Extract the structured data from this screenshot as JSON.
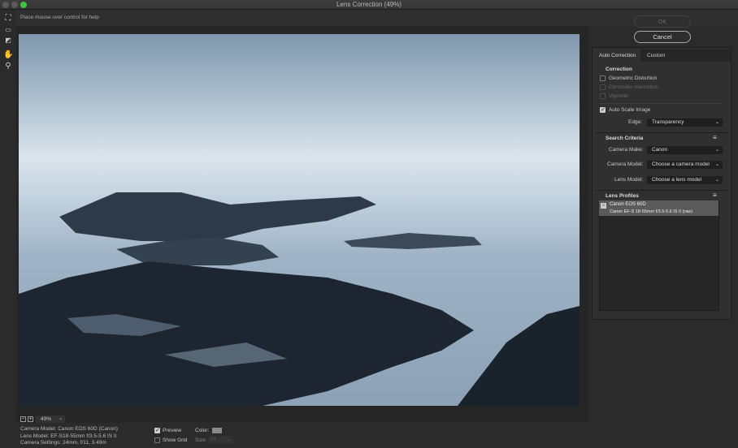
{
  "window": {
    "title": "Lens Correction (49%)"
  },
  "help_text": "Place mouse over control for help",
  "tools": [
    "remove-distortion",
    "straighten",
    "move-grid",
    "hand",
    "zoom"
  ],
  "buttons": {
    "ok": "OK",
    "cancel": "Cancel"
  },
  "tabs": [
    {
      "label": "Auto Correction",
      "active": true
    },
    {
      "label": "Custom",
      "active": false
    }
  ],
  "correction": {
    "heading": "Correction",
    "items": [
      {
        "label": "Geometric Distortion",
        "checked": false,
        "enabled": true
      },
      {
        "label": "Chromatic Aberration",
        "checked": false,
        "enabled": false
      },
      {
        "label": "Vignette",
        "checked": false,
        "enabled": false
      }
    ],
    "auto_scale": {
      "label": "Auto Scale Image",
      "checked": true
    },
    "edge_label": "Edge:",
    "edge_value": "Transparency"
  },
  "search": {
    "heading": "Search Criteria",
    "make_label": "Camera Make:",
    "make_value": "Canon",
    "model_label": "Camera Model:",
    "model_value": "Choose a camera model",
    "lens_label": "Lens Model:",
    "lens_value": "Choose a lens model"
  },
  "profiles": {
    "heading": "Lens Profiles",
    "items": [
      {
        "camera": "Canon EOS 60D",
        "lens": "Canon EF-S 18-55mm f/3.5-5.6 IS II (raw)"
      }
    ]
  },
  "zoom": {
    "value": "49%"
  },
  "info": {
    "camera_model": "Camera Model: Canon EOS 60D (Canon)",
    "lens_model": "Lens Model: EF-S18-55mm f/3.5-5.6 IS II",
    "camera_settings": "Camera Settings: 24mm, f/11, 3.49m"
  },
  "options": {
    "preview_label": "Preview",
    "preview_checked": true,
    "grid_label": "Show Grid",
    "grid_checked": false,
    "color_label": "Color:",
    "size_label": "Size:",
    "size_value": "64",
    "grid_color": "#8a8a8a"
  }
}
